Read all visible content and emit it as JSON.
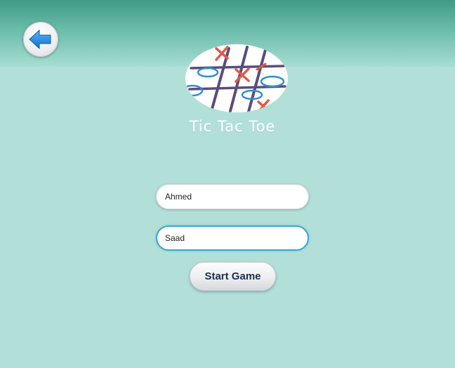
{
  "header": {
    "back_icon": "arrow-left-icon",
    "colors": {
      "band_top": "#3f9a86",
      "background": "#b2e0d8",
      "arrow": "#1e88e5"
    }
  },
  "logo": {
    "icon": "tic-tac-toe-board-icon",
    "title": "Tic Tac Toe"
  },
  "form": {
    "player1_value": "Ahmed",
    "player2_value": "Saad",
    "start_label": "Start Game",
    "focus_color": "#3aa6d6"
  }
}
